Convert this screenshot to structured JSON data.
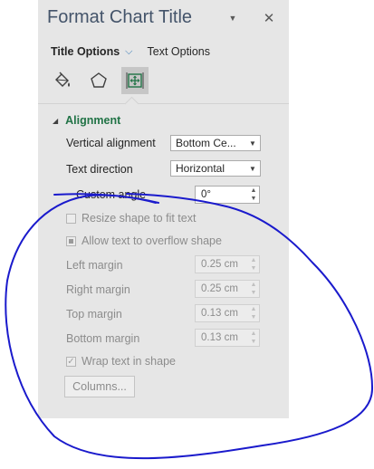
{
  "pane": {
    "title": "Format Chart Title",
    "close_symbol": "✕"
  },
  "option_tabs": {
    "active": "Title Options",
    "other": "Text Options"
  },
  "category_icons": [
    "fill-line-icon",
    "effects-pentagon-icon",
    "size-properties-icon"
  ],
  "section": {
    "title": "Alignment"
  },
  "fields": {
    "vertical_alignment": {
      "label": "Vertical alignment",
      "value": "Bottom Ce..."
    },
    "text_direction": {
      "label": "Text direction",
      "value": "Horizontal"
    },
    "custom_angle": {
      "label": "Custom angle",
      "value": "0°"
    }
  },
  "checkboxes": {
    "resize_shape": {
      "label": "Resize shape to fit text",
      "state": "unchecked",
      "enabled": false
    },
    "allow_overflow": {
      "label": "Allow text to overflow shape",
      "state": "indeterminate",
      "enabled": false
    },
    "wrap_text": {
      "label": "Wrap text in shape",
      "state": "checked",
      "enabled": false
    }
  },
  "margins": {
    "left": {
      "label": "Left margin",
      "value": "0.25 cm"
    },
    "right": {
      "label": "Right margin",
      "value": "0.25 cm"
    },
    "top": {
      "label": "Top margin",
      "value": "0.13 cm"
    },
    "bottom": {
      "label": "Bottom margin",
      "value": "0.13 cm"
    }
  },
  "columns_button": {
    "label": "Columns..."
  },
  "colors": {
    "pane_bg": "#e6e6e6",
    "title": "#44546a",
    "section_green": "#217346",
    "annotation_ink": "#1a1acc",
    "disabled_text": "#8c8c8c"
  }
}
